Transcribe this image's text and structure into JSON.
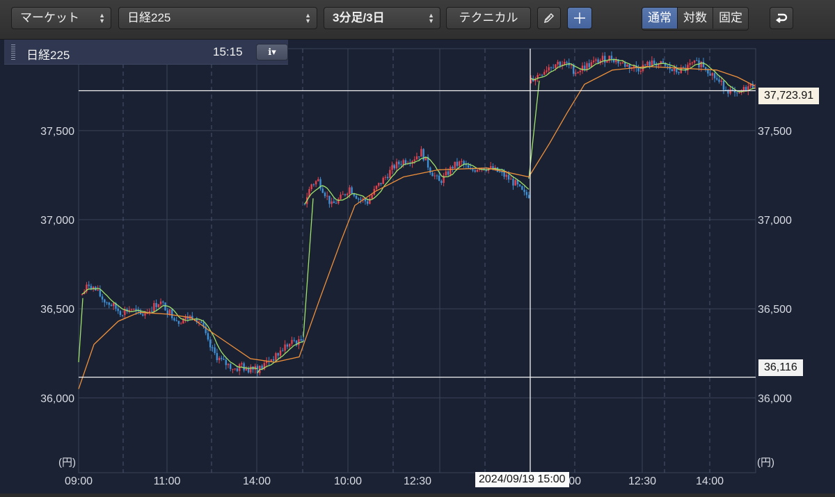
{
  "toolbar": {
    "market_label": "マーケット",
    "index_label": "日経225",
    "period_label": "3分足/3日",
    "technical_label": "テクニカル",
    "scale_options": [
      "通常",
      "対数",
      "固定"
    ],
    "active_scale": "通常",
    "icons": [
      "pencil-icon",
      "crosshair-icon",
      "undo-icon"
    ]
  },
  "legend": {
    "name": "日経225",
    "time": "15:15",
    "info_icon": "info-icon"
  },
  "chart_data": {
    "type": "candlestick",
    "title": "",
    "yunit": "(円)",
    "ylim": [
      35580,
      37960
    ],
    "yticks": [
      36000,
      36500,
      37000,
      37500
    ],
    "ytick_labels": [
      "36,000",
      "36,500",
      "37,000",
      "37,500"
    ],
    "xtick_labels": [
      "09:00",
      "11:00",
      "14:00",
      "10:00",
      "12:30",
      "15:00",
      "12:30",
      "14:00"
    ],
    "date_label": "2024/09/19 15:00",
    "hlines": [
      {
        "value": 37723.91,
        "label": "37,723.91"
      },
      {
        "value": 36116,
        "label": "36,116"
      }
    ],
    "up_color": "#e8414b",
    "down_color": "#3e8fd4",
    "short_ma_color": "#9fe36a",
    "long_ma_color": "#f0913a",
    "series": [
      {
        "name": "day1",
        "points": [
          [
            0.0,
            36580
          ],
          [
            0.04,
            36640
          ],
          [
            0.08,
            36600
          ],
          [
            0.12,
            36550
          ],
          [
            0.17,
            36520
          ],
          [
            0.22,
            36480
          ],
          [
            0.28,
            36500
          ],
          [
            0.33,
            36460
          ],
          [
            0.38,
            36490
          ],
          [
            0.44,
            36540
          ],
          [
            0.5,
            36480
          ],
          [
            0.55,
            36430
          ],
          [
            0.6,
            36450
          ],
          [
            0.64,
            36460
          ],
          [
            0.68,
            36420
          ],
          [
            0.72,
            36300
          ],
          [
            0.76,
            36240
          ],
          [
            0.8,
            36200
          ],
          [
            0.84,
            36180
          ],
          [
            0.88,
            36160
          ],
          [
            0.91,
            36190
          ],
          [
            0.94,
            36140
          ],
          [
            0.96,
            36180
          ]
        ]
      },
      {
        "name": "day1b",
        "points": [
          [
            0.0,
            36160
          ],
          [
            0.1,
            36170
          ],
          [
            0.2,
            36200
          ],
          [
            0.3,
            36220
          ],
          [
            0.4,
            36230
          ],
          [
            0.5,
            36260
          ],
          [
            0.6,
            36290
          ],
          [
            0.7,
            36300
          ],
          [
            0.8,
            36320
          ],
          [
            0.9,
            36310
          ],
          [
            1.0,
            36340
          ]
        ]
      },
      {
        "name": "day2",
        "points": [
          [
            0.0,
            37100
          ],
          [
            0.03,
            37200
          ],
          [
            0.06,
            37220
          ],
          [
            0.09,
            37150
          ],
          [
            0.12,
            37080
          ],
          [
            0.16,
            37120
          ],
          [
            0.2,
            37180
          ],
          [
            0.24,
            37120
          ],
          [
            0.28,
            37100
          ],
          [
            0.32,
            37180
          ],
          [
            0.36,
            37240
          ],
          [
            0.4,
            37300
          ],
          [
            0.44,
            37330
          ],
          [
            0.48,
            37340
          ],
          [
            0.52,
            37380
          ],
          [
            0.56,
            37280
          ],
          [
            0.6,
            37210
          ],
          [
            0.63,
            37250
          ],
          [
            0.66,
            37300
          ],
          [
            0.7,
            37320
          ],
          [
            0.74,
            37270
          ],
          [
            0.78,
            37300
          ],
          [
            0.82,
            37290
          ],
          [
            0.86,
            37270
          ],
          [
            0.9,
            37240
          ],
          [
            0.94,
            37200
          ],
          [
            0.98,
            37140
          ]
        ]
      },
      {
        "name": "day3",
        "points": [
          [
            0.0,
            37780
          ],
          [
            0.04,
            37820
          ],
          [
            0.08,
            37860
          ],
          [
            0.12,
            37880
          ],
          [
            0.16,
            37870
          ],
          [
            0.2,
            37830
          ],
          [
            0.24,
            37860
          ],
          [
            0.28,
            37880
          ],
          [
            0.32,
            37900
          ],
          [
            0.36,
            37910
          ],
          [
            0.4,
            37880
          ],
          [
            0.44,
            37860
          ],
          [
            0.48,
            37850
          ],
          [
            0.52,
            37870
          ],
          [
            0.56,
            37880
          ],
          [
            0.6,
            37860
          ],
          [
            0.64,
            37830
          ],
          [
            0.68,
            37840
          ],
          [
            0.72,
            37870
          ],
          [
            0.76,
            37880
          ],
          [
            0.8,
            37830
          ],
          [
            0.84,
            37770
          ],
          [
            0.88,
            37730
          ],
          [
            0.92,
            37690
          ],
          [
            0.96,
            37740
          ],
          [
            1.0,
            37760
          ]
        ]
      }
    ]
  }
}
